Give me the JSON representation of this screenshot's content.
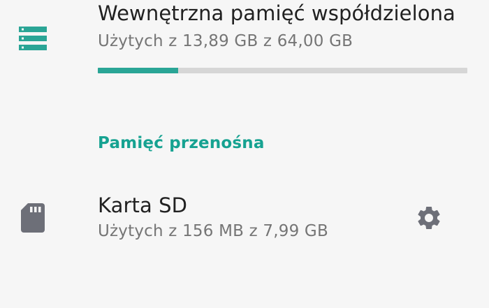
{
  "internal_storage": {
    "title": "Wewnętrzna pamięć współdzielona",
    "usage": "Użytych z 13,89 GB z 64,00 GB",
    "used_fraction": 0.217,
    "icon": "storage-icon"
  },
  "portable_section": {
    "header": "Pamięć przenośna"
  },
  "sd_card": {
    "title": "Karta SD",
    "usage": "Użytych z 156 MB z 7,99 GB",
    "icon": "sd-card-icon",
    "settings_icon": "gear-icon"
  },
  "colors": {
    "accent": "#16a291",
    "progress": "#2aa596",
    "track": "#d6d6d6",
    "icon_gray": "#6d6f78",
    "text_primary": "#212121",
    "text_secondary": "#757575",
    "background": "#f6f6f6"
  }
}
